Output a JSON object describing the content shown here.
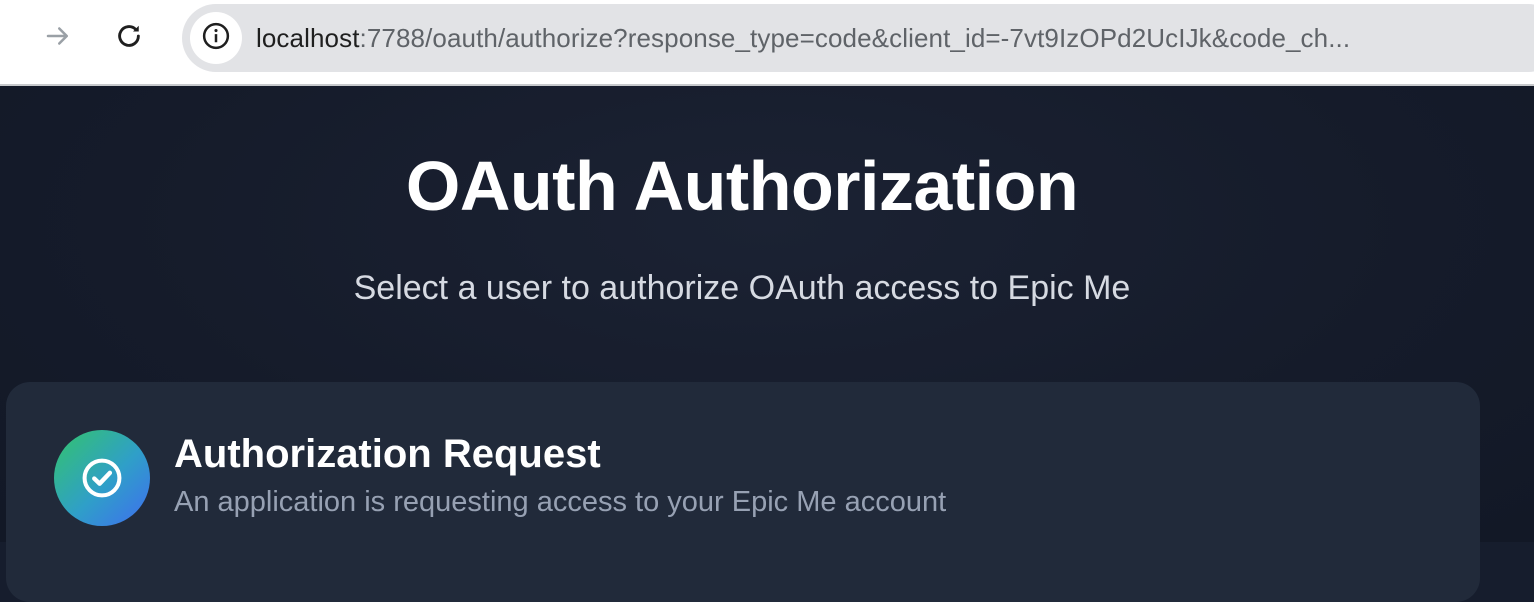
{
  "browser": {
    "url_host": "localhost",
    "url_rest": ":7788/oauth/authorize?response_type=code&client_id=-7vt9IzOPd2UcIJk&code_ch..."
  },
  "icons": {
    "forward": "forward-arrow-icon",
    "reload": "reload-icon",
    "site_info": "info-icon",
    "card": "check-circle-icon"
  },
  "page": {
    "title": "OAuth Authorization",
    "subtitle": "Select a user to authorize OAuth access to Epic Me"
  },
  "card": {
    "title": "Authorization Request",
    "description": "An application is requesting access to your Epic Me account"
  },
  "colors": {
    "page_background": "#161d2d",
    "card_background": "#212a3a",
    "omnibox_background": "#e2e3e6",
    "icon_gradient_start": "#34c46b",
    "icon_gradient_end": "#3f6df0"
  }
}
